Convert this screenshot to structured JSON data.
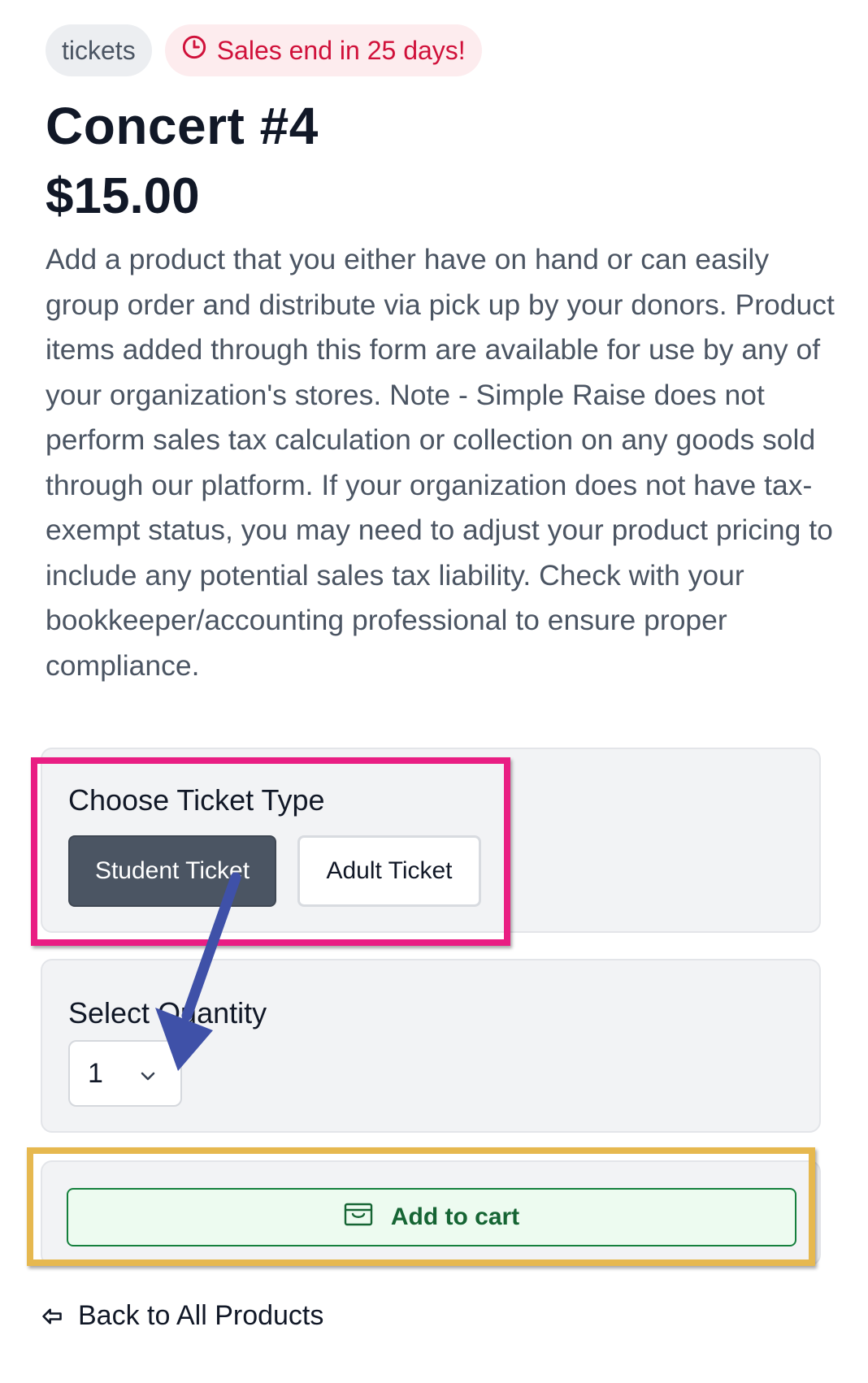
{
  "badges": {
    "category": "tickets",
    "sale": "Sales end in 25 days!"
  },
  "product": {
    "title": "Concert #4",
    "price": "$15.00",
    "description": "Add a product that you either have on hand or can easily group order and distribute via pick up by your donors. Product items added through this form are available for use by any of your organization's stores. Note - Simple Raise does not perform sales tax calculation or collection on any goods sold through our platform. If your organization does not have tax-exempt status, you may need to adjust your product pricing to include any potential sales tax liability. Check with your bookkeeper/accounting professional to ensure proper compliance."
  },
  "ticket_type": {
    "label": "Choose Ticket Type",
    "options": [
      "Student Ticket",
      "Adult Ticket"
    ],
    "selected": "Student Ticket"
  },
  "quantity": {
    "label": "Select Quantity",
    "value": "1"
  },
  "cart": {
    "button_label": "Add to cart"
  },
  "nav": {
    "back_label": "Back to All Products"
  },
  "icons": {
    "sale": "clock-icon",
    "quantity": "chevron-down-icon",
    "cart": "cart-icon",
    "back": "back-arrow-icon"
  },
  "colors": {
    "sale_text": "#d0113a",
    "selected_ticket": "#4b5563",
    "cart_accent": "#15803d",
    "highlight_pink": "#e91e83",
    "highlight_gold": "#e6b84f",
    "annotation_arrow": "#3f51a8"
  }
}
